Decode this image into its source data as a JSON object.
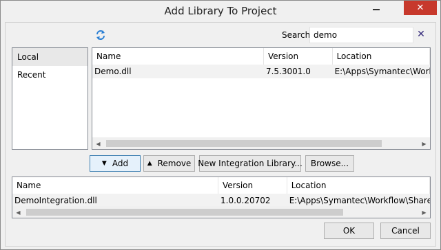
{
  "window": {
    "title": "Add Library To Project"
  },
  "toolbar": {
    "refresh_icon": "refresh-icon",
    "search_label": "Search",
    "search_value": "demo",
    "clear_icon": "✕"
  },
  "sources": {
    "items": [
      {
        "label": "Local",
        "selected": true
      },
      {
        "label": "Recent",
        "selected": false
      }
    ]
  },
  "available": {
    "columns": [
      "Name",
      "Version",
      "Location"
    ],
    "rows": [
      {
        "name": "Demo.dll",
        "version": "7.5.3001.0",
        "location": "E:\\Apps\\Symantec\\Workflo"
      }
    ]
  },
  "actions": {
    "add": "Add",
    "remove": "Remove",
    "new_integration": "New Integration Library...",
    "browse": "Browse..."
  },
  "selected": {
    "columns": [
      "Name",
      "Version",
      "Location"
    ],
    "rows": [
      {
        "name": "DemoIntegration.dll",
        "version": "1.0.0.20702",
        "location": "E:\\Apps\\Symantec\\Workflow\\Shared\\c"
      }
    ]
  },
  "footer": {
    "ok": "OK",
    "cancel": "Cancel"
  },
  "colors": {
    "close_button": "#c7392c",
    "clear_icon": "#34297a",
    "refresh_icon": "#2a7fd4"
  }
}
